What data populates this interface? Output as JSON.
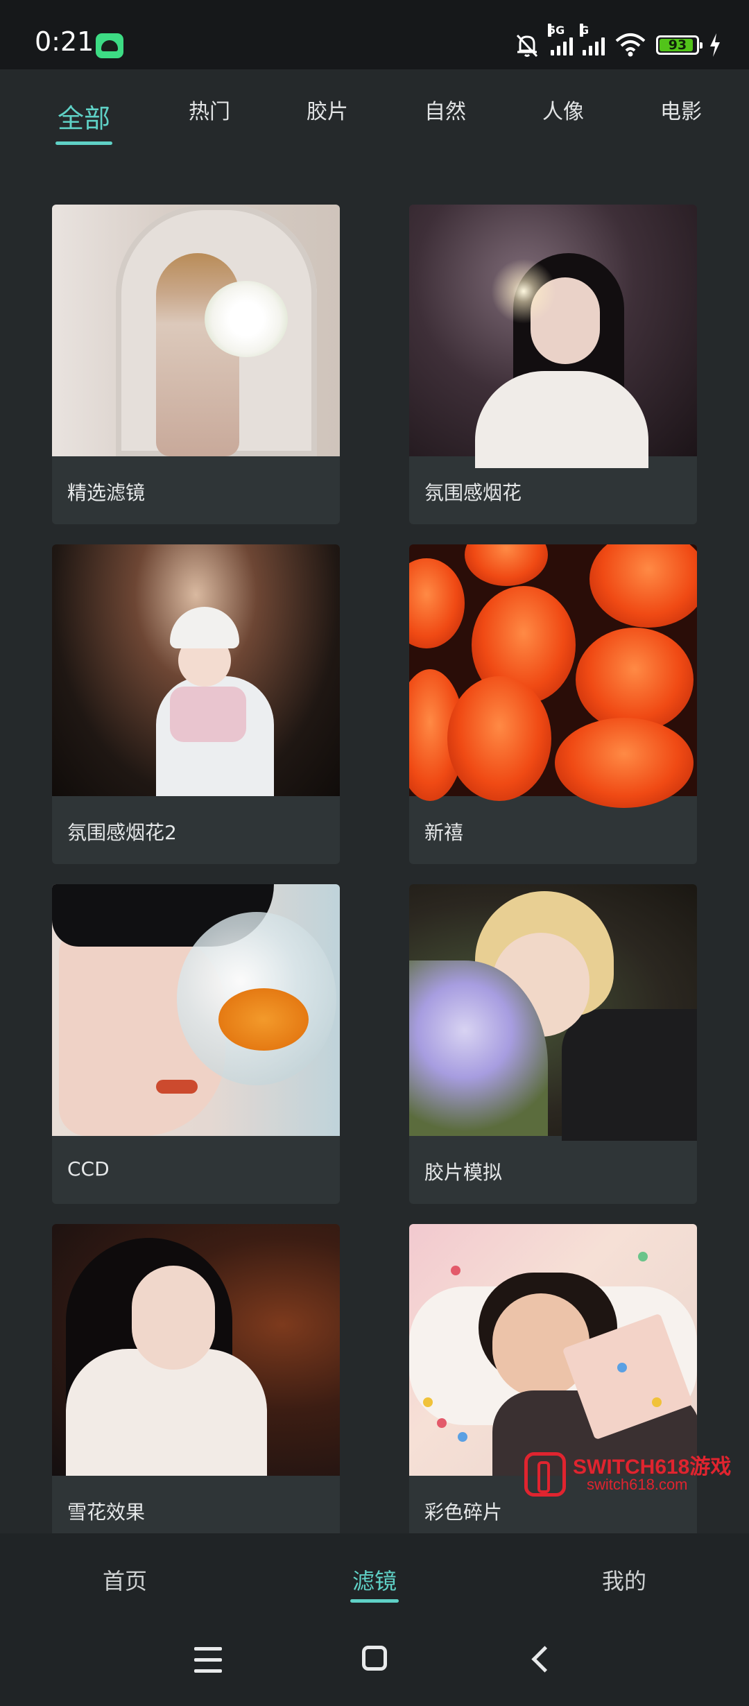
{
  "status_bar": {
    "time": "0:21",
    "network_5g": "5G",
    "network_g": "G",
    "battery": "93"
  },
  "categories": {
    "items": [
      "全部",
      "热门",
      "胶片",
      "自然",
      "人像",
      "电影"
    ],
    "active_index": 0
  },
  "filters": [
    {
      "label": "精选滤镜"
    },
    {
      "label": "氛围感烟花"
    },
    {
      "label": "氛围感烟花2"
    },
    {
      "label": "新禧"
    },
    {
      "label": "CCD"
    },
    {
      "label": "胶片模拟"
    },
    {
      "label": "雪花效果"
    },
    {
      "label": "彩色碎片"
    }
  ],
  "watermark": {
    "title": "SWITCH618游戏",
    "subtitle": "switch618.com"
  },
  "bottom_nav": {
    "items": [
      "首页",
      "滤镜",
      "我的"
    ],
    "active_index": 1
  },
  "colors": {
    "accent": "#5fd1c6",
    "background": "#25292b",
    "card": "#2f3537"
  }
}
